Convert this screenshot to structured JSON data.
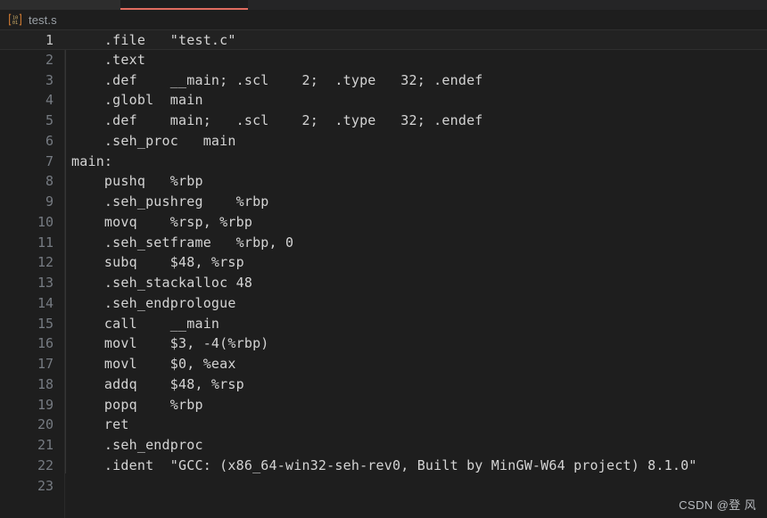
{
  "window": {
    "background_color": "#1e1e1e"
  },
  "tabs": {
    "active_index": 1,
    "accent_color": "#e06c5f",
    "items": [
      {
        "label": "",
        "active": false
      },
      {
        "label": "",
        "active": true
      },
      {
        "label": "",
        "active": false
      }
    ]
  },
  "breadcrumb": {
    "icon": "binary-file-icon",
    "icon_bracket_color": "#cc7832",
    "icon_digit_color": "#d4b26a",
    "label": "test.s"
  },
  "editor": {
    "language": "assembly",
    "active_line": 1,
    "gutter_color": "#767b82",
    "active_gutter_color": "#c6c6c6",
    "text_color": "#d4d4d4",
    "active_line_background": "#222222",
    "lines": [
      {
        "number": "1",
        "text": "    .file   \"test.c\""
      },
      {
        "number": "2",
        "text": "    .text"
      },
      {
        "number": "3",
        "text": "    .def    __main; .scl    2;  .type   32; .endef"
      },
      {
        "number": "4",
        "text": "    .globl  main"
      },
      {
        "number": "5",
        "text": "    .def    main;   .scl    2;  .type   32; .endef"
      },
      {
        "number": "6",
        "text": "    .seh_proc   main"
      },
      {
        "number": "7",
        "text": "main:"
      },
      {
        "number": "8",
        "text": "    pushq   %rbp"
      },
      {
        "number": "9",
        "text": "    .seh_pushreg    %rbp"
      },
      {
        "number": "10",
        "text": "    movq    %rsp, %rbp"
      },
      {
        "number": "11",
        "text": "    .seh_setframe   %rbp, 0"
      },
      {
        "number": "12",
        "text": "    subq    $48, %rsp"
      },
      {
        "number": "13",
        "text": "    .seh_stackalloc 48"
      },
      {
        "number": "14",
        "text": "    .seh_endprologue"
      },
      {
        "number": "15",
        "text": "    call    __main"
      },
      {
        "number": "16",
        "text": "    movl    $3, -4(%rbp)"
      },
      {
        "number": "17",
        "text": "    movl    $0, %eax"
      },
      {
        "number": "18",
        "text": "    addq    $48, %rsp"
      },
      {
        "number": "19",
        "text": "    popq    %rbp"
      },
      {
        "number": "20",
        "text": "    ret"
      },
      {
        "number": "21",
        "text": "    .seh_endproc"
      },
      {
        "number": "22",
        "text": "    .ident  \"GCC: (x86_64-win32-seh-rev0, Built by MinGW-W64 project) 8.1.0\""
      },
      {
        "number": "23",
        "text": ""
      }
    ]
  },
  "watermark": {
    "text": "CSDN @登 风"
  }
}
